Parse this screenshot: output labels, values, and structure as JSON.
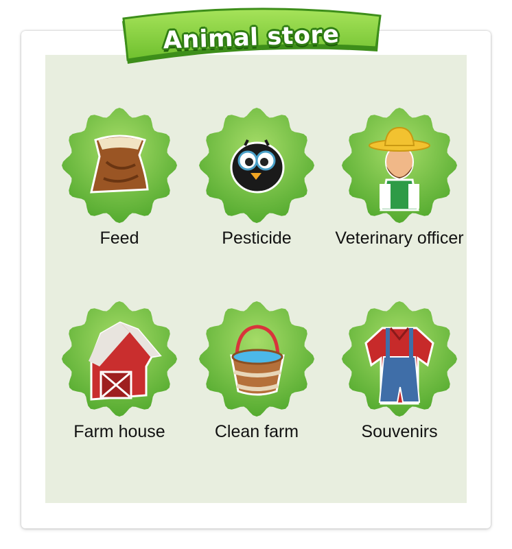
{
  "header": {
    "title": "Animal store"
  },
  "items": [
    {
      "label": "Feed",
      "icon": "feed-sack-icon"
    },
    {
      "label": "Pesticide",
      "icon": "bird-pest-icon"
    },
    {
      "label": "Veterinary officer",
      "icon": "farmer-vet-icon"
    },
    {
      "label": "Farm house",
      "icon": "barn-icon"
    },
    {
      "label": "Clean farm",
      "icon": "water-bucket-icon"
    },
    {
      "label": "Souvenirs",
      "icon": "overalls-icon"
    }
  ],
  "colors": {
    "badge_light": "#9ad65a",
    "badge_dark": "#4fae2c",
    "panel": "#e8eedf",
    "banner": "#8fd43d"
  }
}
